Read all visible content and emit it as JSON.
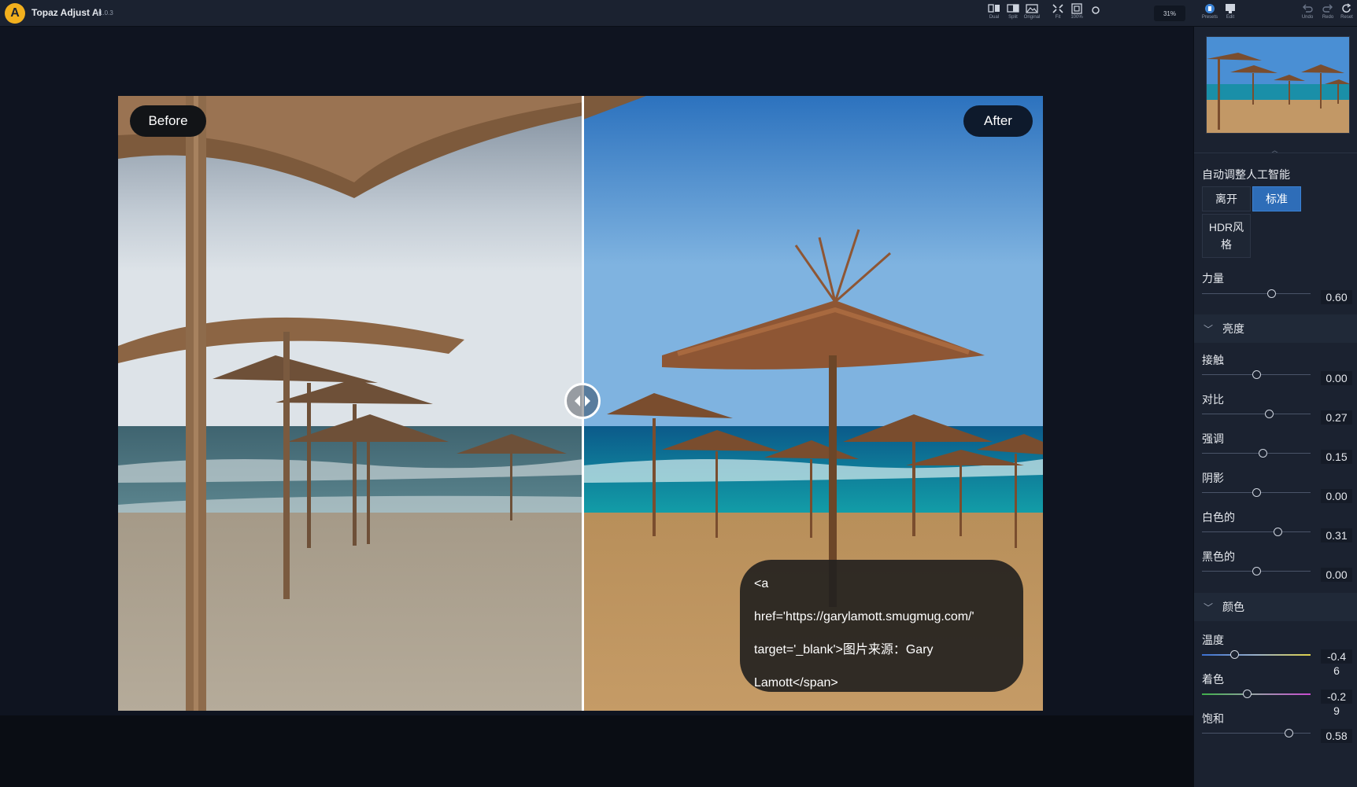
{
  "app": {
    "title": "Topaz Adjust AI",
    "version": "v1.0.3",
    "logo_letter": "A"
  },
  "toolbar": {
    "view_buttons": [
      {
        "label": "Dual",
        "icon": "dual-view-icon"
      },
      {
        "label": "Split",
        "icon": "split-view-icon"
      },
      {
        "label": "Original",
        "icon": "original-view-icon"
      }
    ],
    "fit_buttons": [
      {
        "label": "Fit",
        "icon": "fit-icon"
      },
      {
        "label": "100%",
        "icon": "actual-size-icon"
      }
    ],
    "zoom": "31%",
    "panel_buttons": [
      {
        "label": "Presets",
        "icon": "presets-icon"
      },
      {
        "label": "Edit",
        "icon": "edit-icon"
      }
    ],
    "history_buttons": [
      {
        "label": "Undo",
        "icon": "undo-icon"
      },
      {
        "label": "Redo",
        "icon": "redo-icon"
      },
      {
        "label": "Reset",
        "icon": "reset-icon"
      }
    ]
  },
  "canvas": {
    "before_label": "Before",
    "after_label": "After",
    "tooltip_lines": [
      "<a",
      "href='https://garylamott.smugmug.com/'",
      "target='_blank'>图片来源：Gary",
      "Lamott</span>"
    ]
  },
  "panel": {
    "auto_ai_title": "自动调整人工智能",
    "modes": [
      "离开",
      "标准",
      "HDR风格"
    ],
    "active_mode": "标准",
    "strength": {
      "label": "力量",
      "value": "0.60",
      "fraction": 0.64
    },
    "brightness_section": "亮度",
    "brightness_sliders": [
      {
        "label": "接触",
        "value": "0.00",
        "fraction": 0.5
      },
      {
        "label": "对比",
        "value": "0.27",
        "fraction": 0.62
      },
      {
        "label": "强调",
        "value": "0.15",
        "fraction": 0.56
      },
      {
        "label": "阴影",
        "value": "0.00",
        "fraction": 0.5
      },
      {
        "label": "白色的",
        "value": "0.31",
        "fraction": 0.7
      },
      {
        "label": "黑色的",
        "value": "0.00",
        "fraction": 0.5
      }
    ],
    "color_section": "颜色",
    "color_sliders": [
      {
        "label": "温度",
        "value_line1": "-0.4",
        "value_line2": "6",
        "fraction": 0.3
      },
      {
        "label": "着色",
        "value_line1": "-0.2",
        "value_line2": "9",
        "fraction": 0.42
      },
      {
        "label": "饱和",
        "value": "0.58",
        "fraction": 0.8
      }
    ]
  }
}
